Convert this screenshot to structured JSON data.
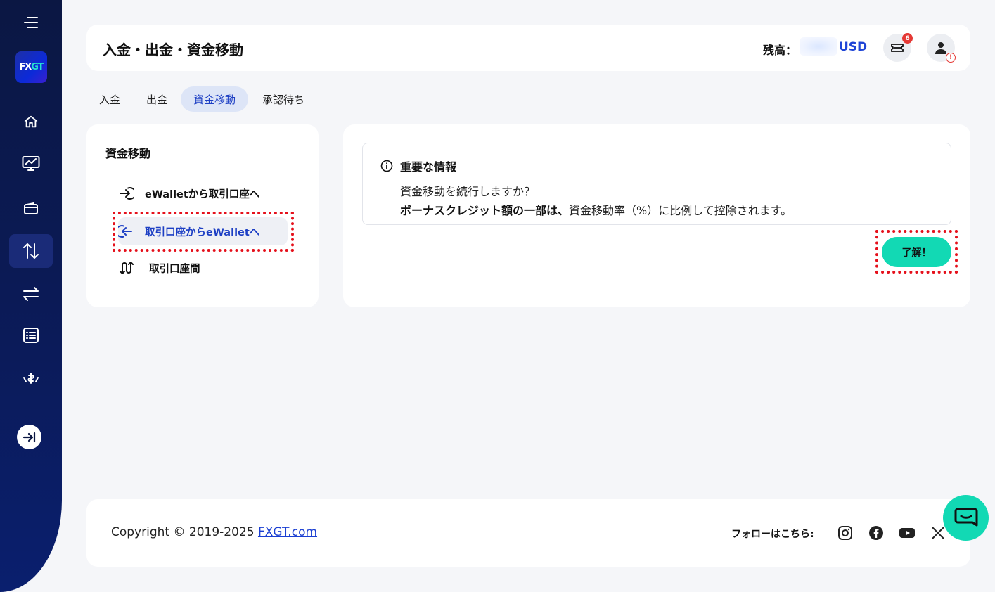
{
  "sidebar": {
    "logo": {
      "fx": "FX",
      "gt": "GT"
    },
    "items": [
      {
        "icon": "home-icon"
      },
      {
        "icon": "chart-monitor-icon"
      },
      {
        "icon": "wallet-icon"
      },
      {
        "icon": "transfer-updown-icon",
        "active": true
      },
      {
        "icon": "exchange-arrows-icon"
      },
      {
        "icon": "list-icon"
      },
      {
        "icon": "hand-money-icon"
      }
    ],
    "expand_icon": "expand-arrow-icon"
  },
  "header": {
    "title": "入金・出金・資金移動",
    "balance_label": "残高：",
    "balance_currency": "USD",
    "ticket_badge": "6",
    "user_alert": "!"
  },
  "tabs": [
    {
      "label": "入金"
    },
    {
      "label": "出金"
    },
    {
      "label": "資金移動",
      "active": true
    },
    {
      "label": "承認待ち"
    }
  ],
  "transfer_menu": {
    "title": "資金移動",
    "items": [
      {
        "label": "eWalletから取引口座へ",
        "icon": "arrow-in-icon"
      },
      {
        "label": "取引口座からeWalletへ",
        "icon": "arrow-out-icon",
        "active": true
      },
      {
        "label": "取引口座間",
        "icon": "swap-loop-icon"
      }
    ]
  },
  "notice": {
    "title": "重要な情報",
    "line1": "資金移動を続行しますか？",
    "line2_bold": "ボーナスクレジット額の一部は、",
    "line2_rest": "資金移動率（%）に比例して控除されます。",
    "ok_button": "了解！"
  },
  "footer": {
    "copyright": "Copyright © 2019-2025 ",
    "link": "FXGT.com",
    "follow_label": "フォローはこちら:",
    "socials": [
      "instagram-icon",
      "facebook-icon",
      "youtube-icon",
      "x-icon"
    ]
  },
  "colors": {
    "sidebar": "#0b1743",
    "accent_blue": "#1e44d6",
    "accent_teal": "#12d9b4",
    "highlight_red": "#e5101b"
  }
}
